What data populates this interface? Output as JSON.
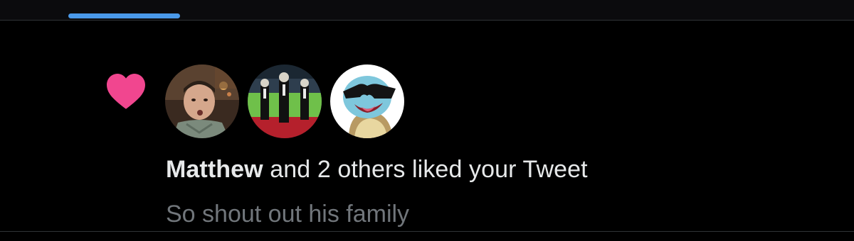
{
  "tabs": {
    "active_indicator_color": "#4a99e9"
  },
  "notification": {
    "type_icon": "heart-icon",
    "heart_color": "#f91880",
    "avatars": [
      {
        "icon": "avatar-man-photo"
      },
      {
        "icon": "avatar-dancers-photo"
      },
      {
        "icon": "avatar-squirtle-sunglasses"
      }
    ],
    "liker_name": "Matthew",
    "action_text": " and 2 others liked your Tweet",
    "tweet_text": "So shout out his family"
  }
}
